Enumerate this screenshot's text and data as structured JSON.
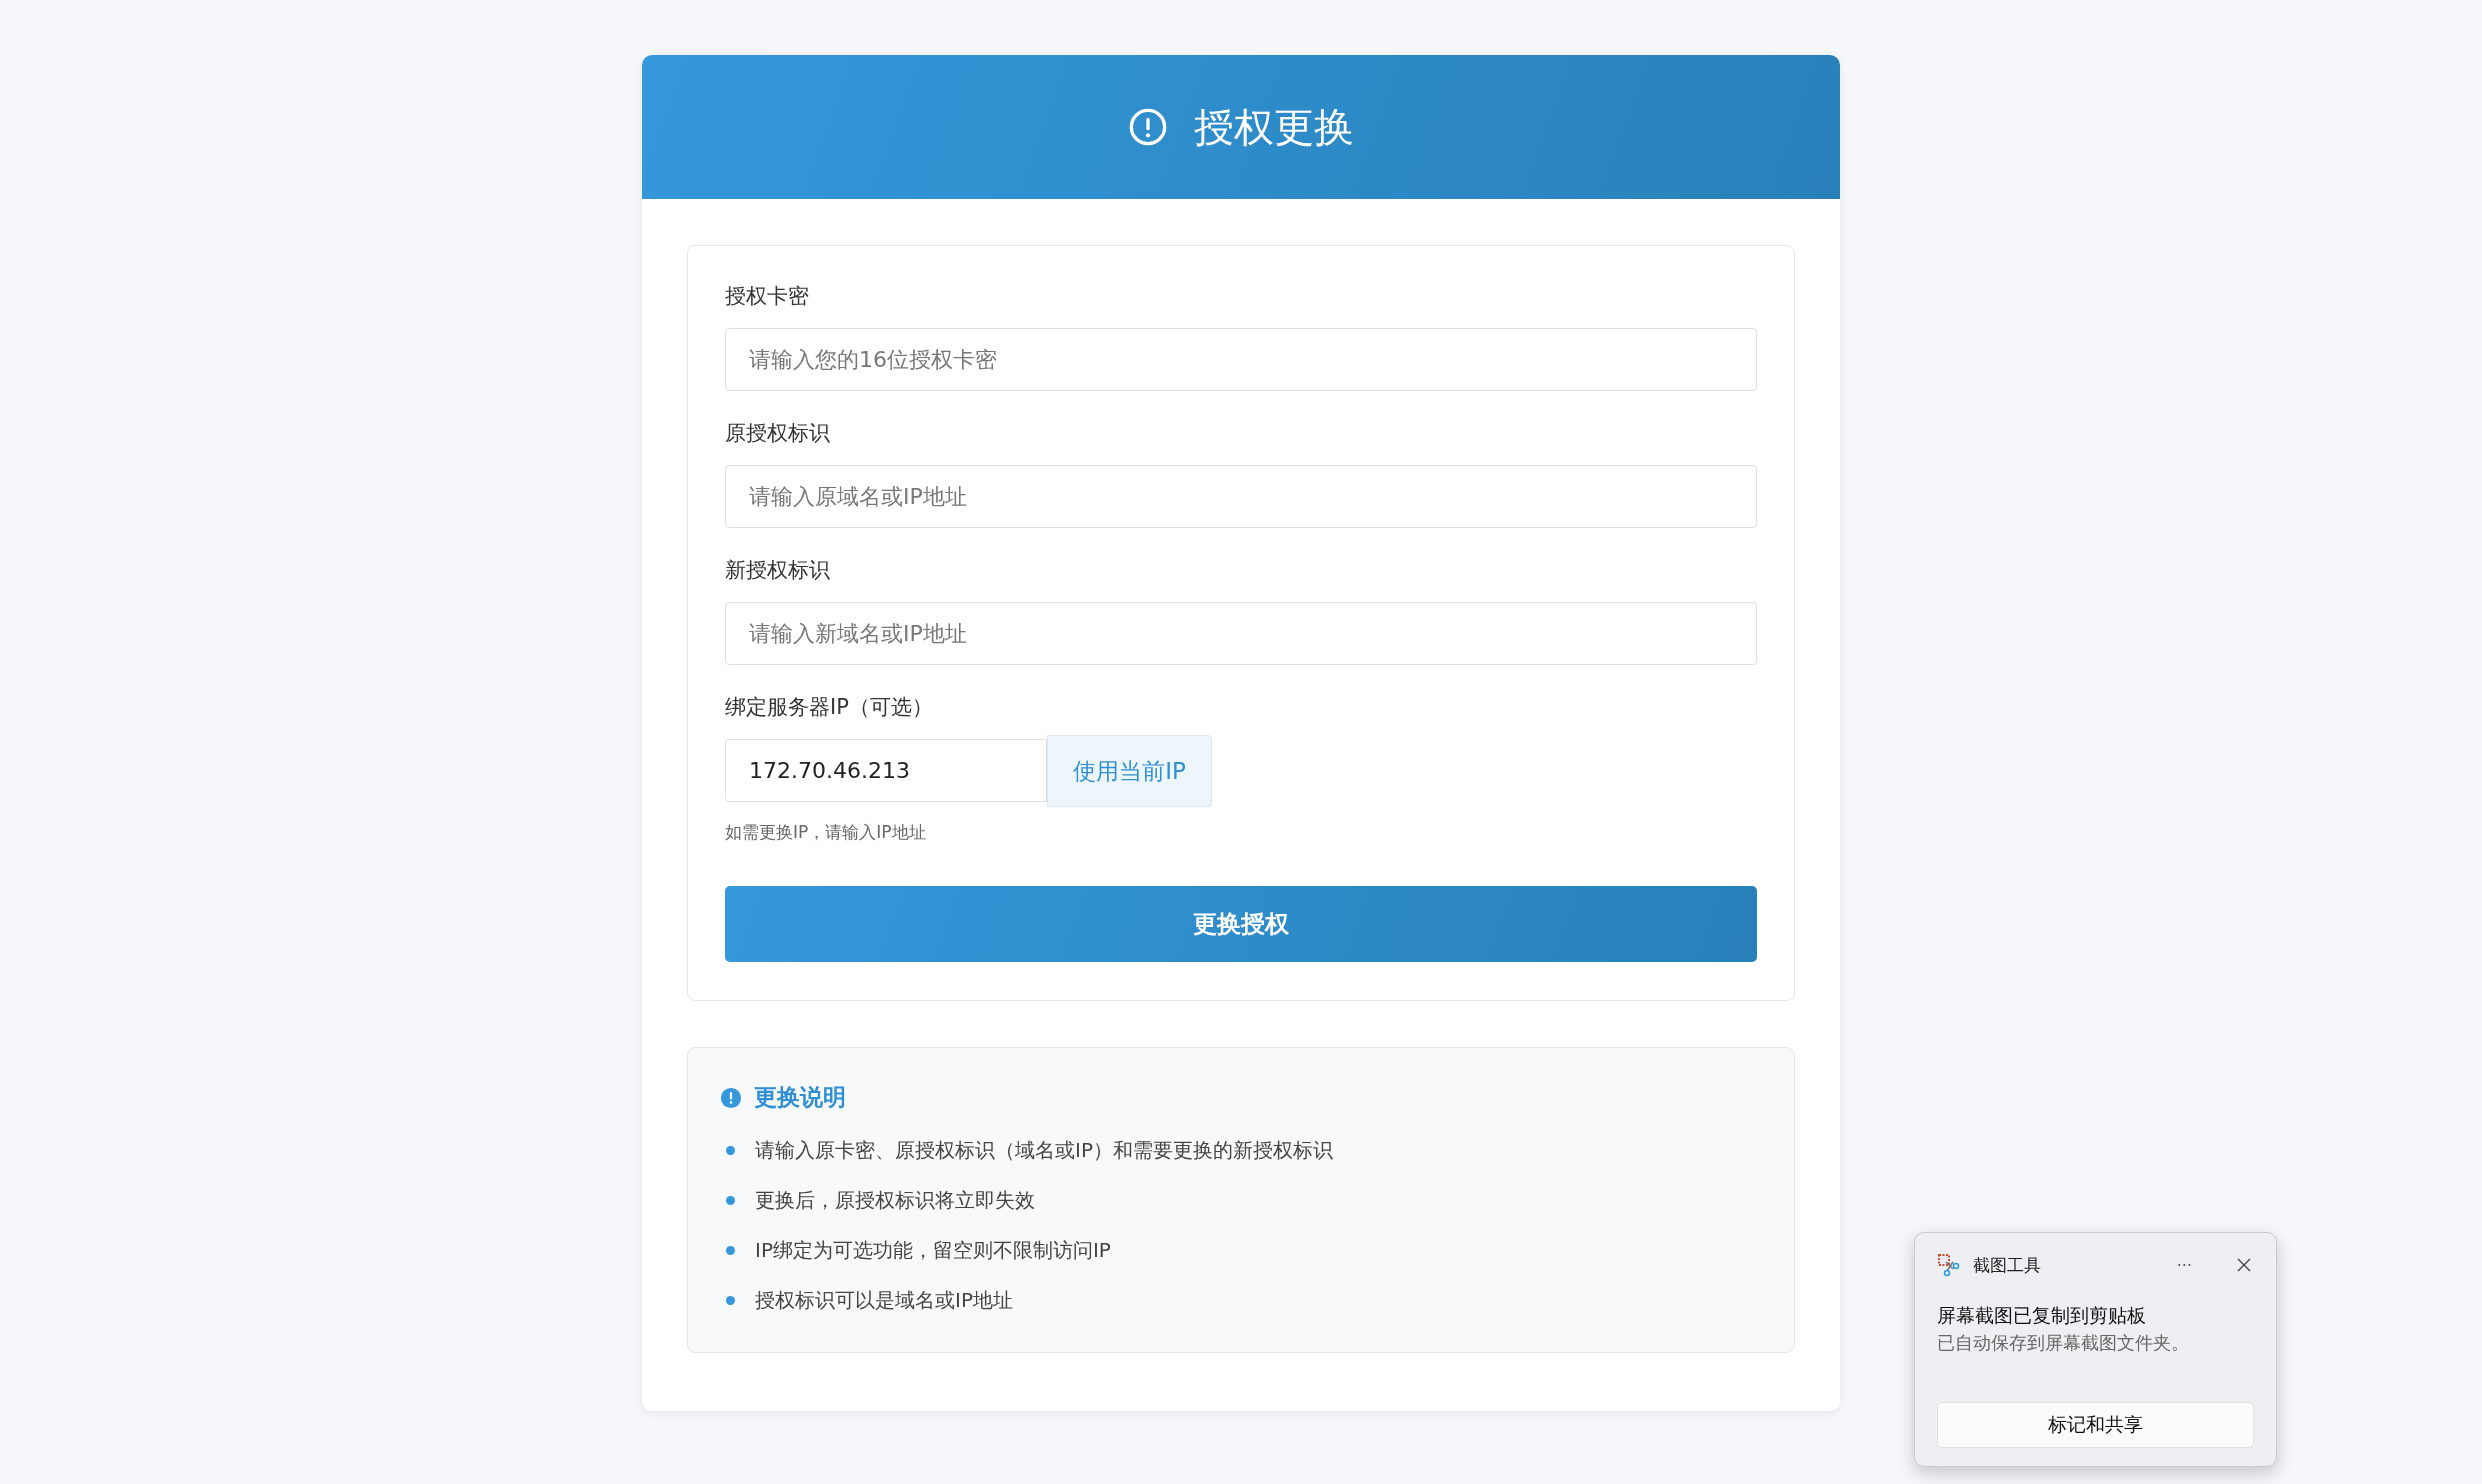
{
  "header": {
    "title": "授权更换"
  },
  "form": {
    "fields": [
      {
        "kind": "text",
        "label": "授权卡密",
        "placeholder": "请输入您的16位授权卡密"
      },
      {
        "kind": "text",
        "label": "原授权标识",
        "placeholder": "请输入原域名或IP地址"
      },
      {
        "kind": "text",
        "label": "新授权标识",
        "placeholder": "请输入新域名或IP地址"
      },
      {
        "kind": "ip",
        "label": "绑定服务器IP（可选）",
        "value": "172.70.46.213",
        "button": "使用当前IP",
        "hint": "如需更换IP，请输入IP地址"
      }
    ],
    "submit": "更换授权"
  },
  "notes": {
    "title": "更换说明",
    "items": [
      "请输入原卡密、原授权标识（域名或IP）和需要更换的新授权标识",
      "更换后，原授权标识将立即失效",
      "IP绑定为可选功能，留空则不限制访问IP",
      "授权标识可以是域名或IP地址"
    ]
  },
  "toast": {
    "app": "截图工具",
    "menu": "···",
    "title": "屏幕截图已复制到剪贴板",
    "message": "已自动保存到屏幕截图文件夹。",
    "action": "标记和共享"
  }
}
